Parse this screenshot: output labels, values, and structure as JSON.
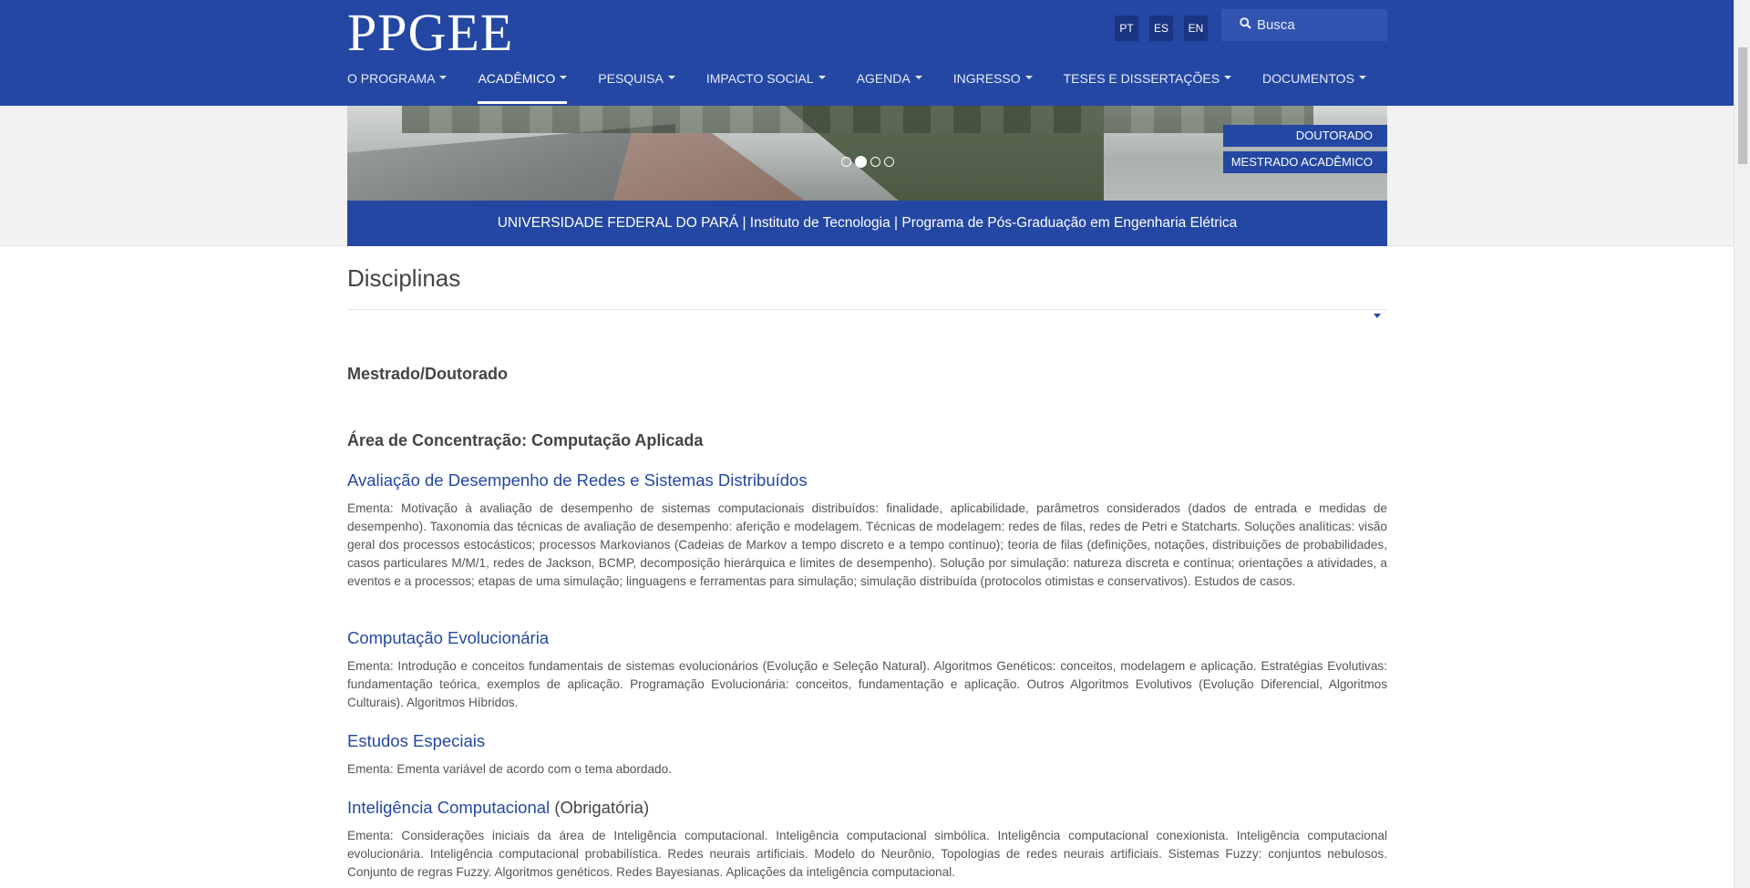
{
  "header": {
    "logo": "PPGEE",
    "languages": [
      "PT",
      "ES",
      "EN"
    ],
    "search_placeholder": "Busca",
    "nav": [
      "O PROGRAMA",
      "ACADÊMICO",
      "PESQUISA",
      "IMPACTO SOCIAL",
      "AGENDA",
      "INGRESSO",
      "TESES E DISSERTAÇÕES",
      "DOCUMENTOS"
    ],
    "active_nav": "ACADÊMICO"
  },
  "banner": {
    "tabs": [
      "DOUTORADO",
      "MESTRADO ACADÊMICO"
    ],
    "slides_count": 4,
    "active_slide": 2,
    "institution_line": "UNIVERSIDADE FEDERAL DO PARÁ | Instituto de Tecnologia | Programa de Pós-Graduação em Engenharia Elétrica"
  },
  "main": {
    "title": "Disciplinas",
    "level_heading": "Mestrado/Doutorado",
    "area_heading": "Área de Concentração: Computação Aplicada",
    "courses": [
      {
        "title": "Avaliação de Desempenho de Redes e Sistemas Distribuídos",
        "suffix": "",
        "description": "Ementa: Motivação à avaliação de desempenho de sistemas computacionais distribuídos: finalidade, aplicabilidade, parâmetros considerados (dados de entrada e medidas de desempenho). Taxonomia das técnicas de avaliação de desempenho: aferição e modelagem. Técnicas de modelagem: redes de filas, redes de Petri e Statcharts. Soluções analíticas: visão geral dos processos estocásticos; processos Markovianos (Cadeias de Markov a tempo discreto e a tempo contínuo); teoria de filas (definições, notações, distribuições de probabilidades, casos particulares M/M/1, redes de Jackson, BCMP, decomposição hierárquica e limites de desempenho). Solução por simulação: natureza discreta e contínua; orientações a atividades, a eventos e a processos; etapas de uma simulação; linguagens e ferramentas para simulação; simulação distribuída (protocolos otimistas e conservativos). Estudos de casos."
      },
      {
        "title": "Computação Evolucionária",
        "suffix": "",
        "description": "Ementa: Introdução e conceitos fundamentais de sistemas evolucionários (Evolução e Seleção Natural). Algoritmos Genéticos: conceitos, modelagem e aplicação. Estratégias Evolutivas: fundamentação teórica, exemplos de aplicação. Programação Evolucionária: conceitos, fundamentação e aplicação. Outros Algoritmos Evolutivos (Evolução Diferencial, Algoritmos Culturais). Algoritmos Híbridos."
      },
      {
        "title": "Estudos Especiais",
        "suffix": "",
        "description": "Ementa: Ementa variável de acordo com o tema abordado."
      },
      {
        "title": "Inteligência Computacional",
        "suffix": " (Obrigatória)",
        "description": "Ementa: Considerações iniciais da área de Inteligência computacional. Inteligência computacional simbólica. Inteligência computacional conexionista. Inteligência computacional evolucionária. Inteligência computacional probabilística. Redes neurais artificiais. Modelo do Neurônio, Topologias de redes neurais artificiais. Sistemas Fuzzy: conjuntos nebulosos. Conjunto de regras Fuzzy. Algoritmos genéticos. Redes Bayesianas. Aplicações da inteligência computacional."
      }
    ]
  }
}
